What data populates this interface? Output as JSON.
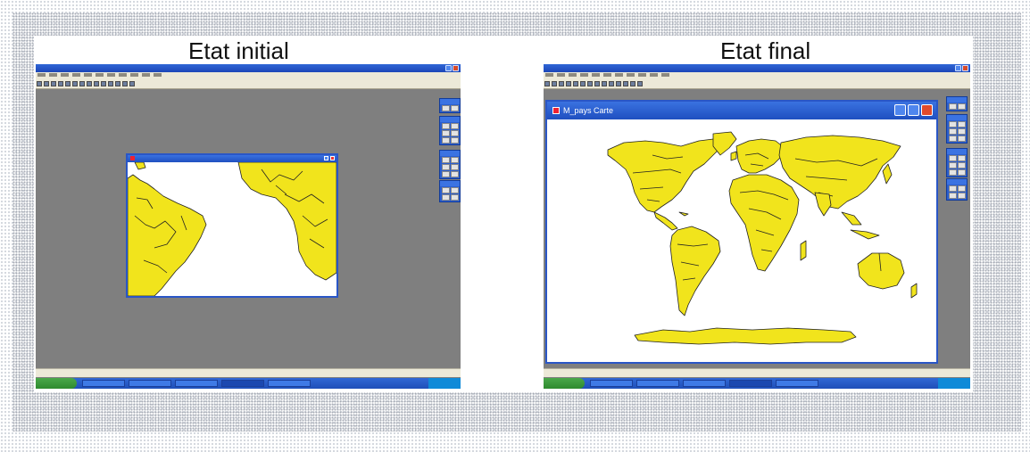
{
  "captions": {
    "left": "Etat initial",
    "right": "Etat final"
  },
  "mapWindow": {
    "title": "M_pays Carte"
  },
  "colors": {
    "land": "#f1e41c",
    "desktop": "#7f7f7f",
    "titlebar": "#2356d0",
    "start": "#3a9a3a"
  },
  "icons": [
    "close-icon",
    "maximize-icon",
    "minimize-icon",
    "map-window-icon"
  ]
}
